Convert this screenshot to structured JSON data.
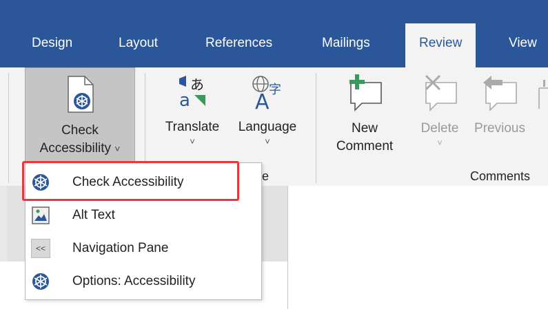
{
  "tabs": [
    {
      "label": "Design",
      "active": false
    },
    {
      "label": "Layout",
      "active": false
    },
    {
      "label": "References",
      "active": false
    },
    {
      "label": "Mailings",
      "active": false
    },
    {
      "label": "Review",
      "active": true
    },
    {
      "label": "View",
      "active": false
    }
  ],
  "ribbon": {
    "check_accessibility": {
      "line1": "Check",
      "line2": "Accessibility",
      "chevron": "˅"
    },
    "translate": {
      "label": "Translate",
      "chevron": "˅"
    },
    "language": {
      "label": "Language",
      "chevron": "˅"
    },
    "new_comment": {
      "line1": "New",
      "line2": "Comment"
    },
    "delete": {
      "label": "Delete",
      "chevron": "˅"
    },
    "previous": {
      "label": "Previous"
    },
    "language_group_label_fragment": "e",
    "comments_group_label": "Comments"
  },
  "menu": {
    "items": [
      {
        "label": "Check Accessibility",
        "icon": "accessibility-icon"
      },
      {
        "label": "Alt Text",
        "icon": "alt-text-icon"
      },
      {
        "label": "Navigation Pane",
        "icon": "navigation-pane-icon"
      },
      {
        "label": "Options: Accessibility",
        "icon": "accessibility-icon"
      }
    ],
    "navigation_pane_glyph": "<<"
  },
  "colors": {
    "tabbar": "#2b579a",
    "accessibility_icon": "#2b579a",
    "highlight_box": "#e8373d",
    "comment_green": "#3a9a5b"
  }
}
